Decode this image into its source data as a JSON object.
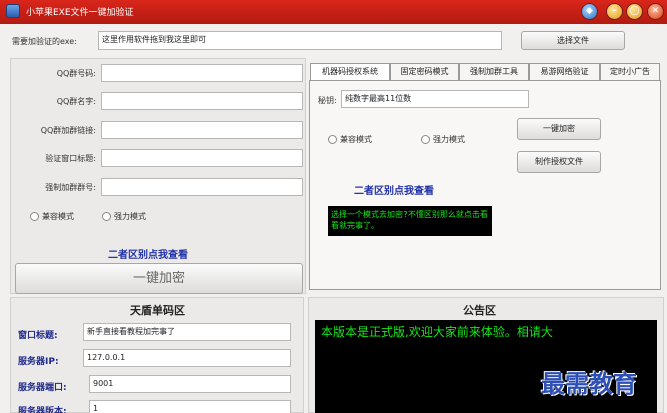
{
  "titlebar": {
    "title": "小苹果EXE文件一键加验证"
  },
  "top_row": {
    "exe_label": "需要加验证的exe:",
    "exe_value": "这里作用软件拖到我这里即可",
    "choose_file_button": "选择文件"
  },
  "left_form": {
    "fields": [
      {
        "label": "QQ群号码:",
        "value": ""
      },
      {
        "label": "QQ群名字:",
        "value": ""
      },
      {
        "label": "QQ群加群链接:",
        "value": ""
      },
      {
        "label": "验证窗口标题:",
        "value": ""
      },
      {
        "label": "强制加群群号:",
        "value": ""
      }
    ],
    "radio_compat": "兼容模式",
    "radio_strong": "强力模式",
    "section_hint": "二者区别点我查看",
    "one_click_button": "一键加密"
  },
  "tabs": {
    "items": [
      "机器码授权系统",
      "固定密码模式",
      "强制加群工具",
      "易游网络验证",
      "定时小广告"
    ],
    "active_index": 0
  },
  "right_panel": {
    "secret_label": "秘钥:",
    "secret_value": "纯数字最高11位数",
    "one_click_button": "一键加密",
    "make_license_button": "制作授权文件",
    "radio_compat": "兼容模式",
    "radio_strong": "强力模式",
    "section_hint": "二者区别点我查看",
    "console_text": "选择一个模式去加密?不懂区别那么就点击看看就完事了。"
  },
  "shield_panel": {
    "title": "天盾单码区",
    "fields": [
      {
        "label": "窗口标题:",
        "value": "新手直接看教程加完事了"
      },
      {
        "label": "服务器IP:",
        "value": "127.0.0.1"
      },
      {
        "label": "服务器端口:",
        "value": "9001"
      },
      {
        "label": "服务器版本:",
        "value": "1"
      }
    ]
  },
  "notice_panel": {
    "title": "公告区",
    "text": "本版本是正式版,欢迎大家前来体验。相请大"
  },
  "watermark": {
    "text": "最需教育"
  },
  "colors": {
    "titlebar": "#c8201a",
    "console_bg": "#000000",
    "console_text": "#17e61c",
    "blue_heading": "#2232a8"
  }
}
